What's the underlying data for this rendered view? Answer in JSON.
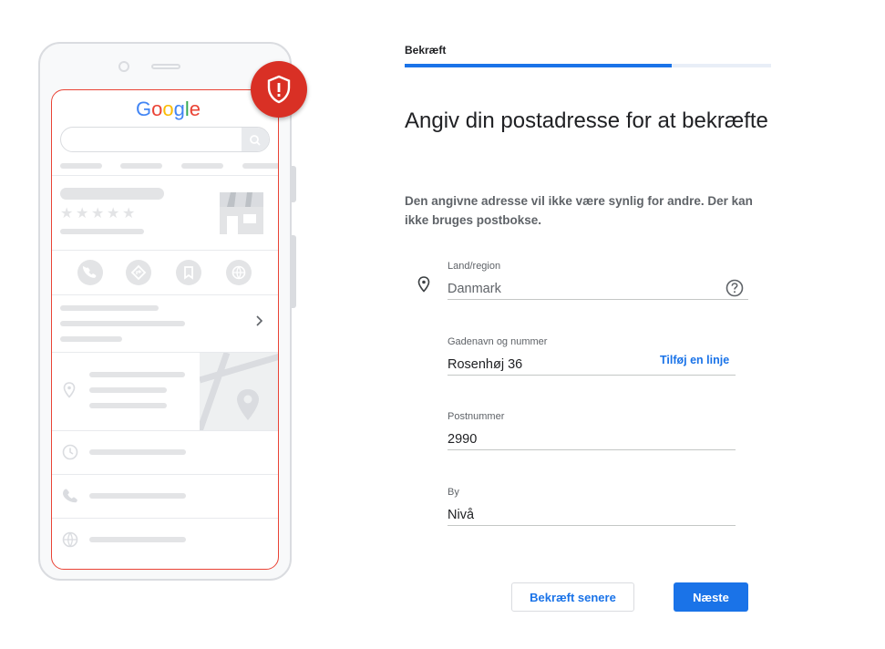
{
  "illustration": {
    "logo_letters": [
      {
        "ch": "G",
        "color": "#4285f4"
      },
      {
        "ch": "o",
        "color": "#ea4335"
      },
      {
        "ch": "o",
        "color": "#fbbc05"
      },
      {
        "ch": "g",
        "color": "#4285f4"
      },
      {
        "ch": "l",
        "color": "#34a853"
      },
      {
        "ch": "e",
        "color": "#ea4335"
      }
    ],
    "badge_icon": "shield-alert-icon",
    "badge_color": "#d93025"
  },
  "header": {
    "step_label": "Bekræft",
    "progress": 0.73
  },
  "main": {
    "heading": "Angiv din postadresse for at bekræfte",
    "description": "Den angivne adresse vil ikke være synlig for andre. Der kan ikke bruges postbokse."
  },
  "form": {
    "country": {
      "label": "Land/region",
      "value": "Danmark",
      "icon": "location-pin-icon",
      "help_icon": "help-circle-icon"
    },
    "street": {
      "label": "Gadenavn og nummer",
      "value": "Rosenhøj 36",
      "add_line": "Tilføj en linje"
    },
    "postal": {
      "label": "Postnummer",
      "value": "2990"
    },
    "city": {
      "label": "By",
      "value": "Nivå"
    }
  },
  "actions": {
    "later": "Bekræft senere",
    "next": "Næste"
  },
  "colors": {
    "accent": "#1a73e8",
    "alert": "#d93025"
  }
}
